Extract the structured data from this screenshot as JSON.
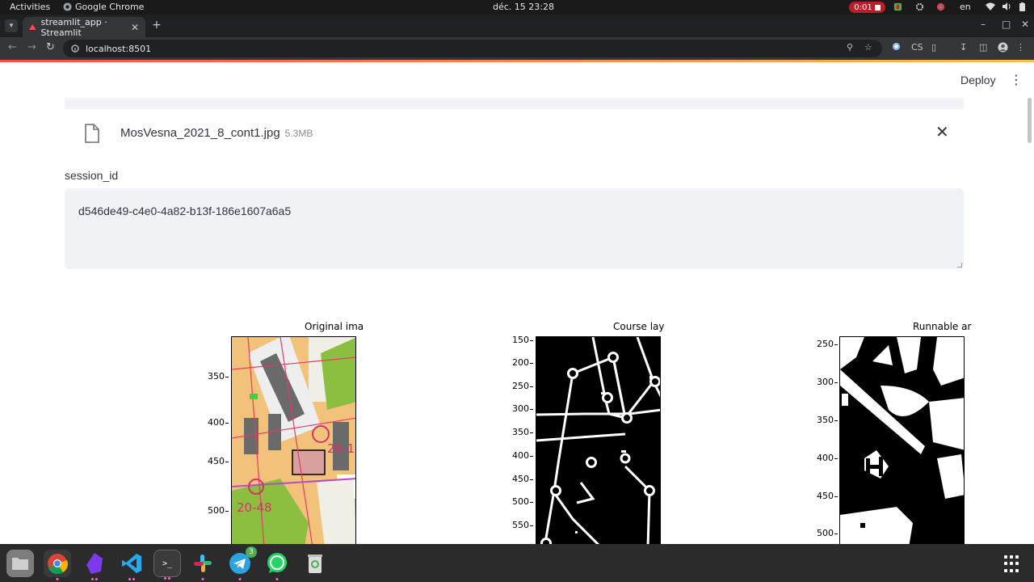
{
  "system_bar": {
    "activities": "Activities",
    "app_name": "Google Chrome",
    "clock": "déc. 15  23:28",
    "record_time": "0:01",
    "language": "en"
  },
  "browser": {
    "tab_title": "streamlit_app · Streamlit",
    "url": "localhost:8501",
    "cs_label": "CS"
  },
  "page": {
    "deploy_label": "Deploy",
    "file": {
      "name": "MosVesna_2021_8_cont1.jpg",
      "size": "5.3MB"
    },
    "session_label": "session_id",
    "session_value": "d546de49-c4e0-4a82-b13f-186e1607a6a5"
  },
  "figures": [
    {
      "title": "Original ima",
      "yticks": [
        "350",
        "400",
        "450",
        "500"
      ]
    },
    {
      "title": "Course lay",
      "yticks": [
        "150",
        "200",
        "250",
        "300",
        "350",
        "400",
        "450",
        "500",
        "550"
      ]
    },
    {
      "title": "Runnable ar",
      "yticks": [
        "250",
        "300",
        "350",
        "400",
        "450",
        "500"
      ]
    }
  ],
  "dock": {
    "telegram_badge": "3"
  },
  "colors": {
    "streamlit_accent": "#ff4b4b",
    "input_bg": "#f0f2f6",
    "text": "#31333f"
  }
}
